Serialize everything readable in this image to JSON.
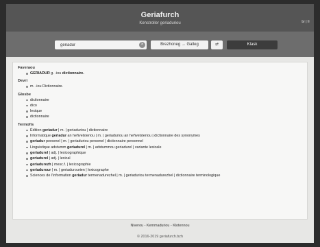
{
  "header": {
    "title": "Geriafurch",
    "subtitle": "Kenstroller geriaduriou",
    "languages": "br | fr"
  },
  "search": {
    "query": "geriadur",
    "direction": "Brezhoneg → Galleg",
    "swap_label": "⇄",
    "submit_label": "Klask"
  },
  "sections": [
    {
      "title": "Faveraou",
      "items": [
        [
          {
            "t": "GERIADUR",
            "b": true
          },
          {
            "t": " g. -iou "
          },
          {
            "t": "dictionnaire.",
            "b": true
          }
        ]
      ]
    },
    {
      "title": "Devri",
      "items": [
        [
          {
            "t": "m. -iou Dictionnaire."
          }
        ]
      ]
    },
    {
      "title": "Glosbe",
      "items": [
        [
          {
            "t": "dictionnaire"
          }
        ],
        [
          {
            "t": "dico"
          }
        ],
        [
          {
            "t": "lexique"
          }
        ],
        [
          {
            "t": "dictionnaire"
          }
        ]
      ]
    },
    {
      "title": "Termofis",
      "items": [
        [
          {
            "t": "Édition "
          },
          {
            "t": "geriadur",
            "b": true
          },
          {
            "t": " | m. | geriaduriou | dictionnaire"
          }
        ],
        [
          {
            "t": "Informatique "
          },
          {
            "t": "geriadur",
            "b": true
          },
          {
            "t": " an heñvelsteriou | m. | geriaduriou an heñvelsteriou | dictionnaire des synonymes"
          }
        ],
        [
          {
            "t": "geriadur",
            "b": true
          },
          {
            "t": " personel | m. | geriaduriou personel | dictionnaire personnel"
          }
        ],
        [
          {
            "t": "Linguistique adstumm "
          },
          {
            "t": "geriadurel",
            "b": true
          },
          {
            "t": " | m. | adstummou geriadurel | variante lexicale"
          }
        ],
        [
          {
            "t": "geriadurel",
            "b": true
          },
          {
            "t": " | adj. | lexicographique"
          }
        ],
        [
          {
            "t": "geriadurel",
            "b": true
          },
          {
            "t": " | adj. | lexical"
          }
        ],
        [
          {
            "t": "geriadurezh",
            "b": true
          },
          {
            "t": " | mesc.f. | lexicographie"
          }
        ],
        [
          {
            "t": "geriadurour",
            "b": true
          },
          {
            "t": " | m. | geriadurourien | lexicographe"
          }
        ],
        [
          {
            "t": "Sciences de l'information "
          },
          {
            "t": "geriadur",
            "b": true
          },
          {
            "t": " termenadurezhel | m. | geriaduriou termenadurezhel | dictionnaire terminologique"
          }
        ]
      ]
    }
  ],
  "footer": {
    "links": "Niverou - Kemmaduriou - Klotennou",
    "copyright": "© 2016-2019 geriafurch.bzh"
  }
}
